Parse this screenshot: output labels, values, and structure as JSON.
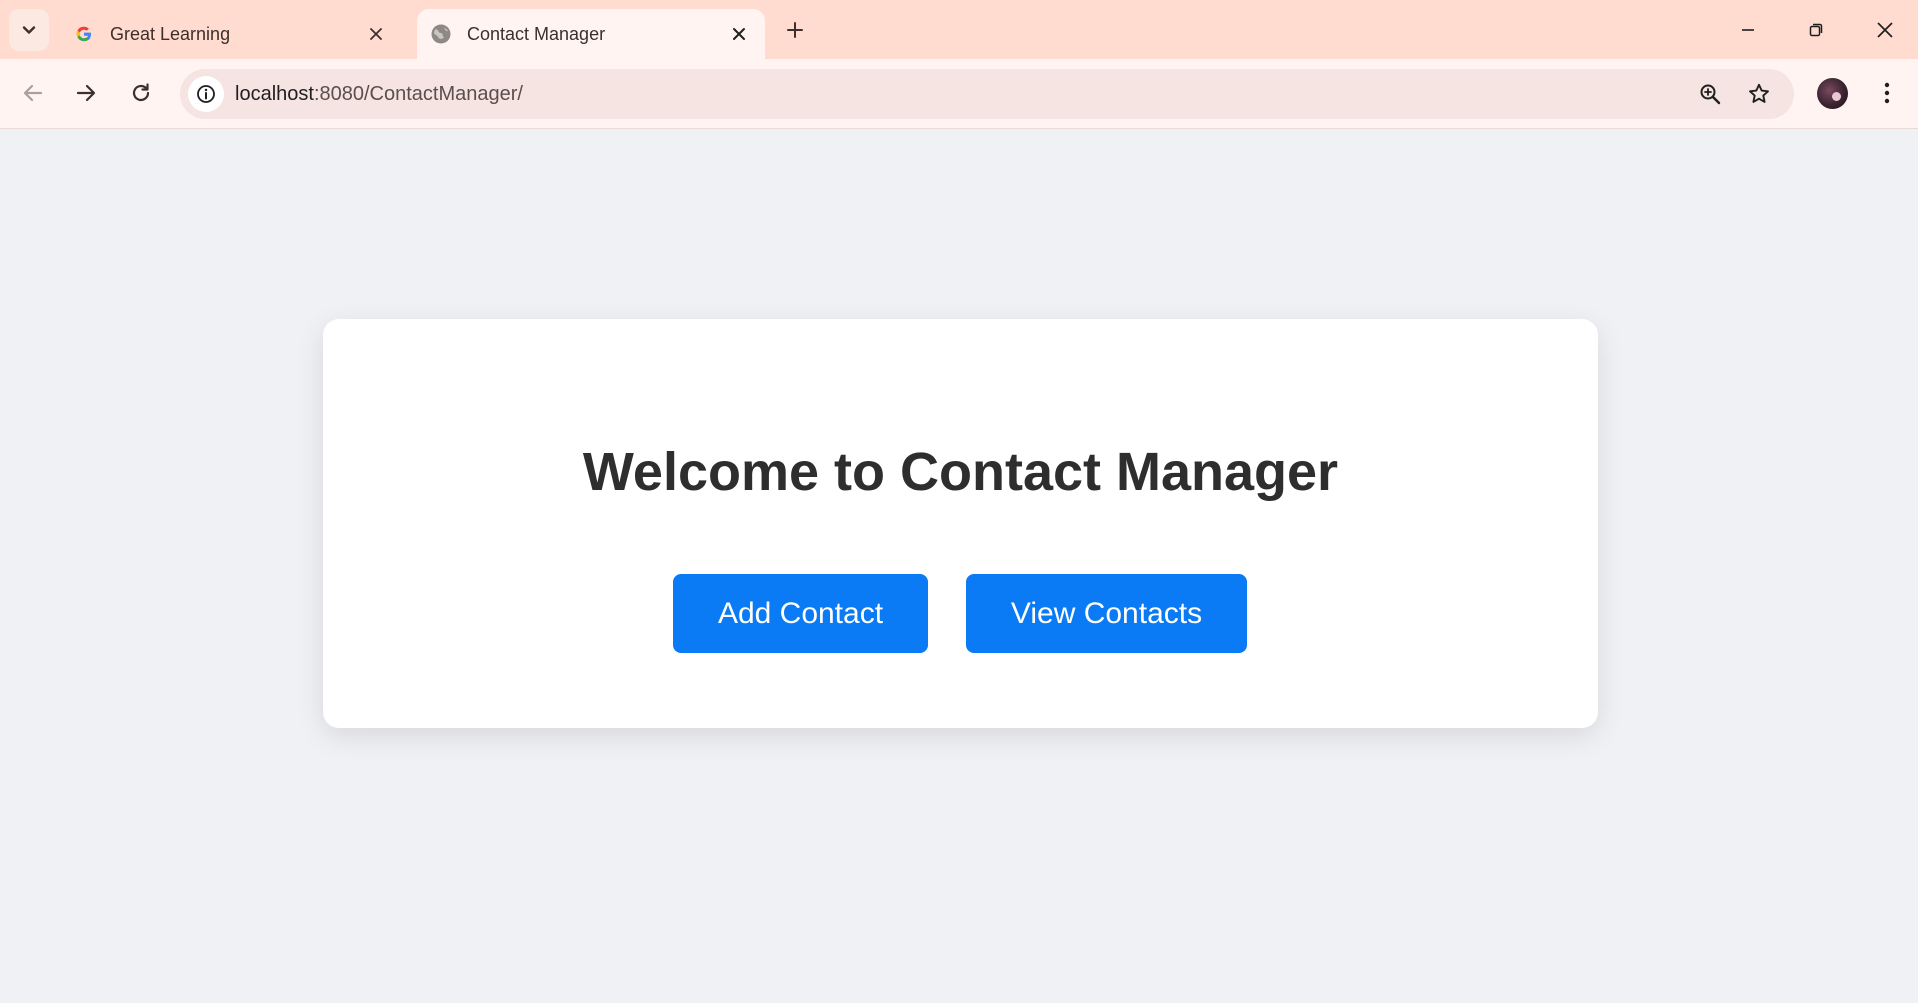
{
  "browser": {
    "tabs": [
      {
        "title": "Great Learning",
        "active": false,
        "favicon": "google-g-icon"
      },
      {
        "title": "Contact Manager",
        "active": true,
        "favicon": "globe-icon"
      }
    ],
    "address": {
      "host": "localhost",
      "rest": ":8080/ContactManager/"
    }
  },
  "page": {
    "heading": "Welcome to Contact Manager",
    "buttons": {
      "add_label": "Add Contact",
      "view_label": "View Contacts"
    }
  },
  "colors": {
    "tabstrip_bg": "#ffdbd0",
    "toolbar_bg": "#fff4f1",
    "page_bg": "#f0f1f5",
    "primary_button": "#0a7bf4",
    "heading_text": "#2e2e2e"
  }
}
